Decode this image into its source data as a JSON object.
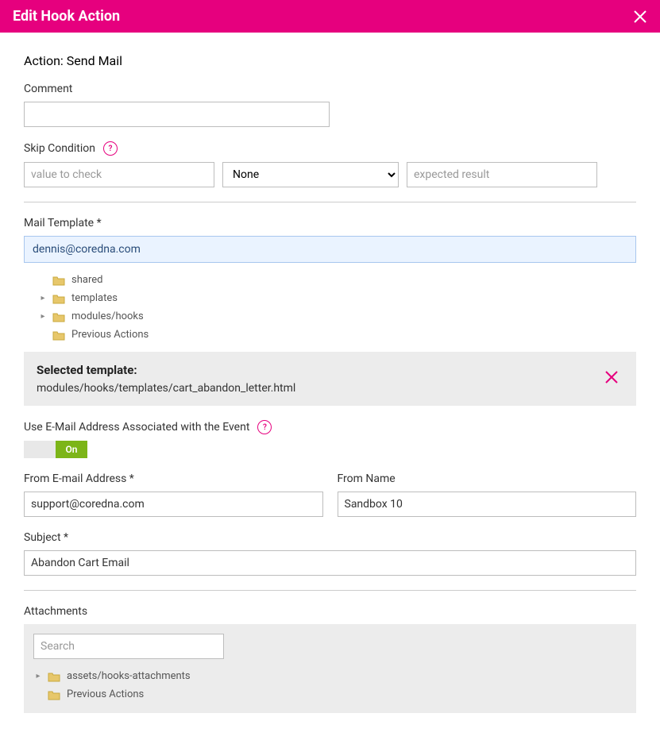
{
  "header": {
    "title": "Edit Hook Action"
  },
  "action": {
    "prefix": "Action: ",
    "name": "Send Mail"
  },
  "comment": {
    "label": "Comment",
    "value": ""
  },
  "skip": {
    "label": "Skip Condition",
    "value_placeholder": "value to check",
    "operator": "None",
    "expected_placeholder": "expected result"
  },
  "mail_template": {
    "label": "Mail Template *",
    "value": "dennis@coredna.com",
    "tree": [
      {
        "label": "shared",
        "expandable": false
      },
      {
        "label": "templates",
        "expandable": true
      },
      {
        "label": "modules/hooks",
        "expandable": true
      },
      {
        "label": "Previous Actions",
        "expandable": false
      }
    ],
    "selected_label": "Selected template:",
    "selected_path": "modules/hooks/templates/cart_abandon_letter.html"
  },
  "use_event_email": {
    "label": "Use E-Mail Address Associated with the Event",
    "state": "On"
  },
  "from_email": {
    "label": "From E-mail Address *",
    "value": "support@coredna.com"
  },
  "from_name": {
    "label": "From Name",
    "value": "Sandbox 10"
  },
  "subject": {
    "label": "Subject *",
    "value": "Abandon Cart Email"
  },
  "attachments": {
    "label": "Attachments",
    "search_placeholder": "Search",
    "tree": [
      {
        "label": "assets/hooks-attachments",
        "expandable": true
      },
      {
        "label": "Previous Actions",
        "expandable": false
      }
    ]
  }
}
